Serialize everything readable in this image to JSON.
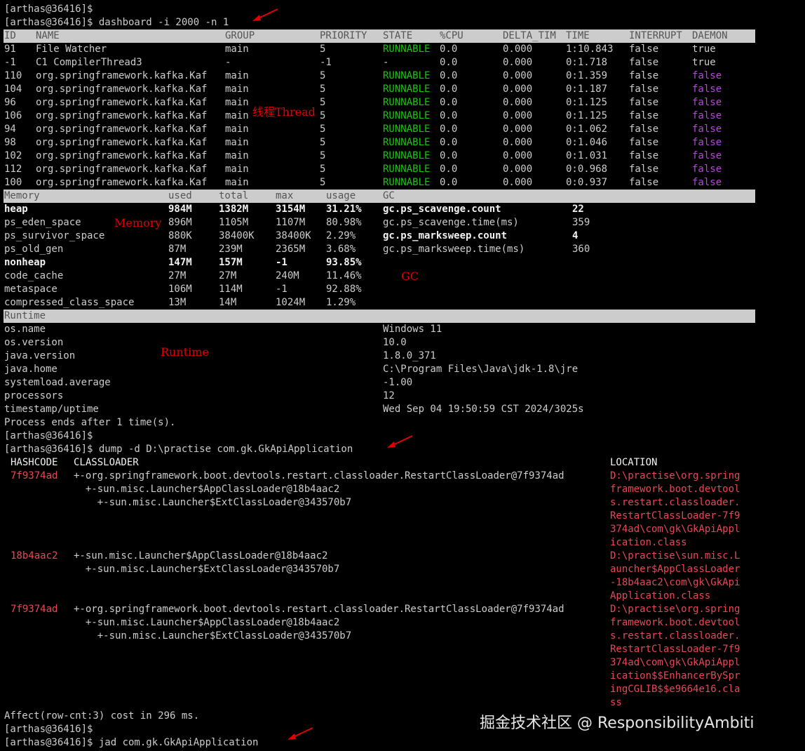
{
  "lines": {
    "prompt1": "[arthas@36416]$",
    "cmd_dashboard": "[arthas@36416]$ dashboard -i 2000 -n 1",
    "process_ends": "Process ends after 1 time(s).",
    "prompt2": "[arthas@36416]$",
    "cmd_dump": "[arthas@36416]$ dump -d D:\\practise com.gk.GkApiApplication",
    "affect": "Affect(row-cnt:3) cost in 296 ms.",
    "prompt3": "[arthas@36416]$",
    "cmd_jad": "[arthas@36416]$ jad com.gk.GkApiApplication"
  },
  "threads": {
    "headers": [
      "ID",
      "NAME",
      "GROUP",
      "PRIORITY",
      "STATE",
      "%CPU",
      "DELTA_TIM",
      "TIME",
      "INTERRUPT",
      "DAEMON"
    ],
    "rows": [
      [
        "91",
        "File Watcher",
        "main",
        "5",
        "RUNNABLE",
        "0.0",
        "0.000",
        "1:10.843",
        "false",
        "true"
      ],
      [
        "-1",
        "C1 CompilerThread3",
        "-",
        "-1",
        "-",
        "0.0",
        "0.000",
        "0:1.718",
        "false",
        "true"
      ],
      [
        "110",
        "org.springframework.kafka.Kaf",
        "main",
        "5",
        "RUNNABLE",
        "0.0",
        "0.000",
        "0:1.359",
        "false",
        "false"
      ],
      [
        "104",
        "org.springframework.kafka.Kaf",
        "main",
        "5",
        "RUNNABLE",
        "0.0",
        "0.000",
        "0:1.187",
        "false",
        "false"
      ],
      [
        "96",
        "org.springframework.kafka.Kaf",
        "main",
        "5",
        "RUNNABLE",
        "0.0",
        "0.000",
        "0:1.125",
        "false",
        "false"
      ],
      [
        "106",
        "org.springframework.kafka.Kaf",
        "main",
        "5",
        "RUNNABLE",
        "0.0",
        "0.000",
        "0:1.125",
        "false",
        "false"
      ],
      [
        "94",
        "org.springframework.kafka.Kaf",
        "main",
        "5",
        "RUNNABLE",
        "0.0",
        "0.000",
        "0:1.062",
        "false",
        "false"
      ],
      [
        "98",
        "org.springframework.kafka.Kaf",
        "main",
        "5",
        "RUNNABLE",
        "0.0",
        "0.000",
        "0:1.046",
        "false",
        "false"
      ],
      [
        "102",
        "org.springframework.kafka.Kaf",
        "main",
        "5",
        "RUNNABLE",
        "0.0",
        "0.000",
        "0:1.031",
        "false",
        "false"
      ],
      [
        "112",
        "org.springframework.kafka.Kaf",
        "main",
        "5",
        "RUNNABLE",
        "0.0",
        "0.000",
        "0:0.968",
        "false",
        "false"
      ],
      [
        "100",
        "org.springframework.kafka.Kaf",
        "main",
        "5",
        "RUNNABLE",
        "0.0",
        "0.000",
        "0:0.937",
        "false",
        "false"
      ]
    ]
  },
  "memory": {
    "headers": [
      "Memory",
      "used",
      "total",
      "max",
      "usage",
      "GC"
    ],
    "rows": [
      [
        "heap",
        "984M",
        "1382M",
        "3154M",
        "31.21%"
      ],
      [
        "ps_eden_space",
        "896M",
        "1105M",
        "1107M",
        "80.98%"
      ],
      [
        "ps_survivor_space",
        "880K",
        "38400K",
        "38400K",
        "2.29%"
      ],
      [
        "ps_old_gen",
        "87M",
        "239M",
        "2365M",
        "3.68%"
      ],
      [
        "nonheap",
        "147M",
        "157M",
        "-1",
        "93.85%"
      ],
      [
        "code_cache",
        "27M",
        "27M",
        "240M",
        "11.46%"
      ],
      [
        "metaspace",
        "106M",
        "114M",
        "-1",
        "92.88%"
      ],
      [
        "compressed_class_space",
        "13M",
        "14M",
        "1024M",
        "1.29%"
      ]
    ]
  },
  "gc": {
    "rows": [
      [
        "gc.ps_scavenge.count",
        "22"
      ],
      [
        "gc.ps_scavenge.time(ms)",
        "359"
      ],
      [
        "gc.ps_marksweep.count",
        "4"
      ],
      [
        "gc.ps_marksweep.time(ms)",
        "360"
      ]
    ]
  },
  "runtime": {
    "header": "Runtime",
    "rows": [
      [
        "os.name",
        "Windows 11"
      ],
      [
        "os.version",
        "10.0"
      ],
      [
        "java.version",
        "1.8.0_371"
      ],
      [
        "java.home",
        "C:\\Program Files\\Java\\jdk-1.8\\jre"
      ],
      [
        "systemload.average",
        "-1.00"
      ],
      [
        "processors",
        "12"
      ],
      [
        "timestamp/uptime",
        "Wed Sep 04 19:50:59 CST 2024/3025s"
      ]
    ]
  },
  "dump": {
    "headers": [
      "HASHCODE",
      "CLASSLOADER",
      "LOCATION"
    ],
    "entries": [
      {
        "hash": "7f9374ad",
        "loaders": [
          "+-org.springframework.boot.devtools.restart.classloader.RestartClassLoader@7f9374ad",
          "  +-sun.misc.Launcher$AppClassLoader@18b4aac2",
          "    +-sun.misc.Launcher$ExtClassLoader@343570b7"
        ],
        "location": [
          "D:\\practise\\org.spring",
          "framework.boot.devtool",
          "s.restart.classloader.",
          "RestartClassLoader-7f9",
          "374ad\\com\\gk\\GkApiAppl",
          "ication.class"
        ]
      },
      {
        "hash": "18b4aac2",
        "loaders": [
          "+-sun.misc.Launcher$AppClassLoader@18b4aac2",
          "  +-sun.misc.Launcher$ExtClassLoader@343570b7"
        ],
        "location": [
          "D:\\practise\\sun.misc.L",
          "auncher$AppClassLoader",
          "-18b4aac2\\com\\gk\\GkApi",
          "Application.class"
        ]
      },
      {
        "hash": "7f9374ad",
        "loaders": [
          "+-org.springframework.boot.devtools.restart.classloader.RestartClassLoader@7f9374ad",
          "  +-sun.misc.Launcher$AppClassLoader@18b4aac2",
          "    +-sun.misc.Launcher$ExtClassLoader@343570b7"
        ],
        "location": [
          "D:\\practise\\org.spring",
          "framework.boot.devtool",
          "s.restart.classloader.",
          "RestartClassLoader-7f9",
          "374ad\\com\\gk\\GkApiAppl",
          "ication$$EnhancerBySpr",
          "ingCGLIB$$e9664e16.cla",
          "ss"
        ]
      }
    ]
  },
  "annotations": {
    "thread": "线程Thread",
    "memory": "Memory",
    "gc": "GC",
    "runtime": "Runtime"
  },
  "watermark": "掘金技术社区 @ ResponsibilityAmbiti",
  "colors": {
    "background": "#000000",
    "text": "#cccccc",
    "header_bar": "#cccccc",
    "runnable": "#16c60c",
    "daemon_false": "#b248d6",
    "dump_red": "#e74856",
    "annotation_red": "#e00000"
  }
}
